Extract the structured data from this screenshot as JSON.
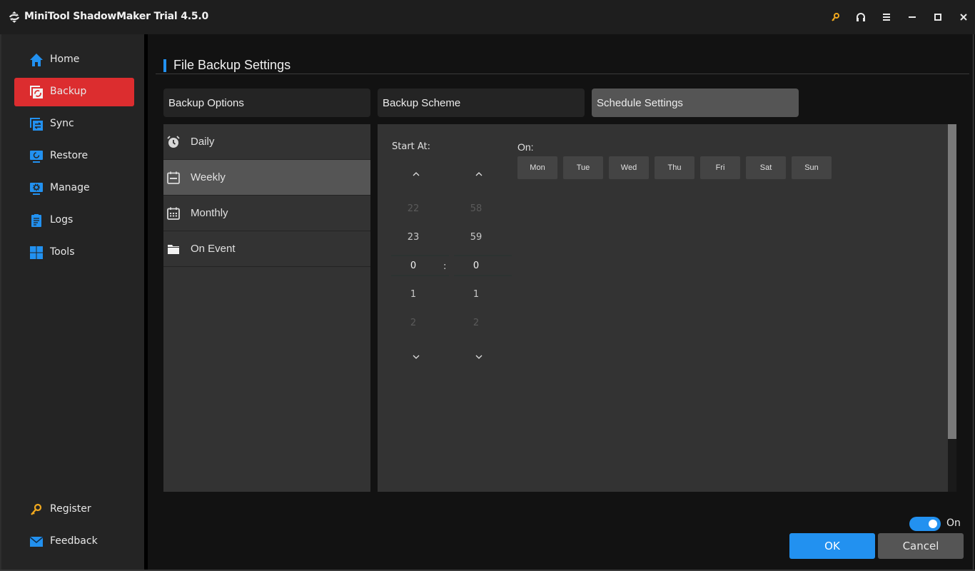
{
  "app": {
    "title": "MiniTool ShadowMaker Trial 4.5.0",
    "logo_icon": "sync-arrows-logo",
    "window_controls": [
      {
        "name": "register-key",
        "icon": "key-icon",
        "color": "#f0a81e"
      },
      {
        "name": "support",
        "icon": "headset-icon"
      },
      {
        "name": "menu",
        "icon": "hamburger-menu-icon"
      },
      {
        "name": "minimize",
        "icon": "minimize-icon"
      },
      {
        "name": "maximize",
        "icon": "maximize-icon"
      },
      {
        "name": "close",
        "icon": "close-icon"
      }
    ]
  },
  "sidebar": {
    "items": [
      {
        "label": "Home",
        "icon": "home-icon"
      },
      {
        "label": "Backup",
        "icon": "backup-icon",
        "active": true
      },
      {
        "label": "Sync",
        "icon": "sync-icon"
      },
      {
        "label": "Restore",
        "icon": "restore-icon"
      },
      {
        "label": "Manage",
        "icon": "manage-icon"
      },
      {
        "label": "Logs",
        "icon": "logs-icon"
      },
      {
        "label": "Tools",
        "icon": "tools-icon"
      }
    ],
    "bottom_items": [
      {
        "label": "Register",
        "icon": "key-icon"
      },
      {
        "label": "Feedback",
        "icon": "mail-icon"
      }
    ]
  },
  "page": {
    "title": "File Backup Settings",
    "tabs": [
      {
        "label": "Backup Options"
      },
      {
        "label": "Backup Scheme"
      },
      {
        "label": "Schedule Settings",
        "active": true
      }
    ],
    "schedule_types": [
      {
        "label": "Daily",
        "icon": "alarm-clock-icon"
      },
      {
        "label": "Weekly",
        "icon": "calendar-week-icon",
        "active": true
      },
      {
        "label": "Monthly",
        "icon": "calendar-month-icon"
      },
      {
        "label": "On Event",
        "icon": "folder-icon"
      }
    ],
    "start_at": {
      "label": "Start At:",
      "hour": {
        "prev2": "22",
        "prev1": "23",
        "value": "0",
        "next1": "1",
        "next2": "2"
      },
      "minute": {
        "prev2": "58",
        "prev1": "59",
        "value": "0",
        "next1": "1",
        "next2": "2"
      },
      "separator": ":"
    },
    "on": {
      "label": "On:",
      "days": [
        "Mon",
        "Tue",
        "Wed",
        "Thu",
        "Fri",
        "Sat",
        "Sun"
      ]
    },
    "schedule_toggle": {
      "label": "On",
      "enabled": true
    },
    "ok_label": "OK",
    "cancel_label": "Cancel"
  },
  "colors": {
    "accent": "#2291f0",
    "active_nav": "#dc2d2f",
    "key": "#f0a81e"
  }
}
